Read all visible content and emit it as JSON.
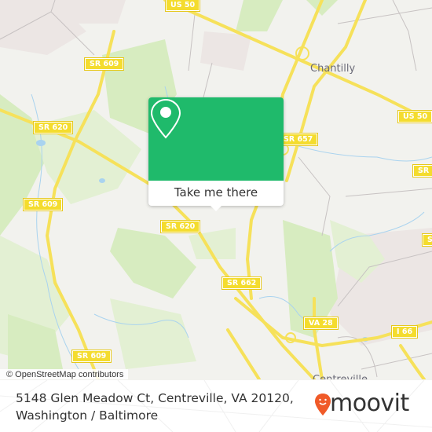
{
  "map": {
    "attribution": "© OpenStreetMap contributors",
    "city_labels": {
      "chantilly": "Chantilly",
      "centreville": "Centreville"
    },
    "road_shields": {
      "us50_top": "US 50",
      "us50_right": "US 50",
      "sr609_north": "SR 609",
      "sr620_west": "SR 620",
      "sr609_west": "SR 609",
      "sr657": "SR 657",
      "sr620_center": "SR 620",
      "sr662": "SR 662",
      "va28": "VA 28",
      "i66": "I 66",
      "sr609_south": "SR 609",
      "sr_right_1": "SR",
      "sr_right_2": "S"
    },
    "colors": {
      "land": "#f2f2ee",
      "park": "#d7ecc0",
      "road": "#f6e15a",
      "water": "#a9d3ef",
      "residential": "#ece6e4"
    }
  },
  "popup": {
    "button_label": "Take me there",
    "accent_color": "#1fba6b",
    "icon": "map-pin-icon"
  },
  "footer": {
    "address_line1": "5148 Glen Meadow Ct, Centreville, VA 20120,",
    "address_line2": "Washington / Baltimore",
    "brand": "moovit",
    "brand_color": "#f05a28"
  }
}
